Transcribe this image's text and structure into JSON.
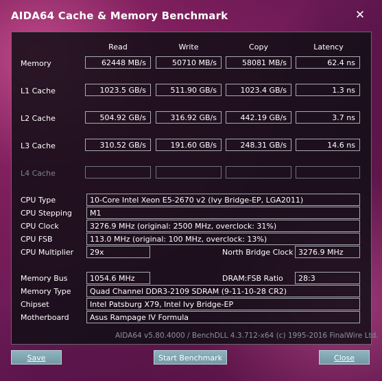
{
  "window": {
    "title": "AIDA64 Cache & Memory Benchmark",
    "close_glyph": "✕"
  },
  "columns": [
    "Read",
    "Write",
    "Copy",
    "Latency"
  ],
  "rows": [
    {
      "label": "Memory",
      "read": "62448 MB/s",
      "write": "50710 MB/s",
      "copy": "58081 MB/s",
      "latency": "62.4 ns"
    },
    {
      "label": "L1 Cache",
      "read": "1023.5 GB/s",
      "write": "511.90 GB/s",
      "copy": "1023.4 GB/s",
      "latency": "1.3 ns"
    },
    {
      "label": "L2 Cache",
      "read": "504.92 GB/s",
      "write": "316.92 GB/s",
      "copy": "442.19 GB/s",
      "latency": "3.7 ns"
    },
    {
      "label": "L3 Cache",
      "read": "310.52 GB/s",
      "write": "191.60 GB/s",
      "copy": "248.31 GB/s",
      "latency": "14.6 ns"
    },
    {
      "label": "L4 Cache",
      "read": "",
      "write": "",
      "copy": "",
      "latency": ""
    }
  ],
  "cpu": {
    "type_label": "CPU Type",
    "type_value": "10-Core Intel Xeon E5-2670 v2  (Ivy Bridge-EP, LGA2011)",
    "stepping_label": "CPU Stepping",
    "stepping_value": "M1",
    "clock_label": "CPU Clock",
    "clock_value": "3276.9 MHz  (original: 2500 MHz, overclock: 31%)",
    "fsb_label": "CPU FSB",
    "fsb_value": "113.0 MHz  (original: 100 MHz, overclock: 13%)",
    "multiplier_label": "CPU Multiplier",
    "multiplier_value": "29x",
    "nb_clock_label": "North Bridge Clock",
    "nb_clock_value": "3276.9 MHz"
  },
  "memory": {
    "bus_label": "Memory Bus",
    "bus_value": "1054.6 MHz",
    "ratio_label": "DRAM:FSB Ratio",
    "ratio_value": "28:3",
    "type_label": "Memory Type",
    "type_value": "Quad Channel DDR3-2109 SDRAM  (9-11-10-28 CR2)",
    "chipset_label": "Chipset",
    "chipset_value": "Intel Patsburg X79, Intel Ivy Bridge-EP",
    "motherboard_label": "Motherboard",
    "motherboard_value": "Asus Rampage IV Formula"
  },
  "footer": "AIDA64 v5.80.4000 / BenchDLL 4.3.712-x64  (c) 1995-2016 FinalWire Ltd.",
  "buttons": {
    "save": "Save",
    "start": "Start Benchmark",
    "close": "Close"
  }
}
